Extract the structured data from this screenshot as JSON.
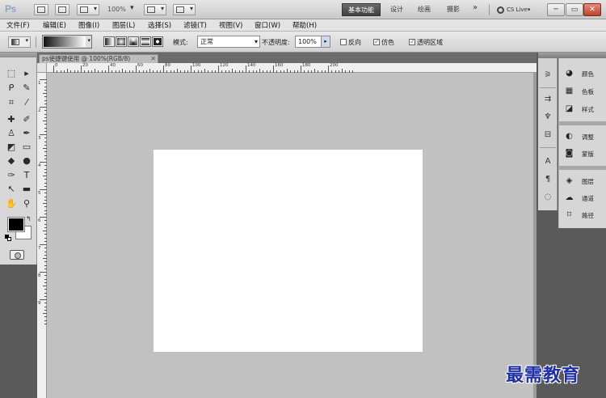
{
  "app": {
    "logo": "Ps",
    "zoom": "100%",
    "workspaces": [
      "基本功能",
      "设计",
      "绘画",
      "摄影"
    ],
    "workspace_more": "»",
    "cs_live": "CS Live"
  },
  "menu": [
    "文件(F)",
    "编辑(E)",
    "图像(I)",
    "图层(L)",
    "选择(S)",
    "滤镜(T)",
    "视图(V)",
    "窗口(W)",
    "帮助(H)"
  ],
  "options": {
    "mode_label": "模式:",
    "mode_value": "正常",
    "opacity_label": "不透明度:",
    "opacity_value": "100%",
    "reverse": "反向",
    "dither": "仿色",
    "transparency": "透明区域",
    "reverse_checked": false,
    "dither_checked": true,
    "transparency_checked": true
  },
  "document": {
    "tab_title": "ps使捷键使用 @ 100%(RGB/8)",
    "tab_close": "✕",
    "ruler_top_labels": [
      "0",
      "20",
      "40",
      "60",
      "80",
      "100",
      "120",
      "140",
      "160",
      "180",
      "200"
    ],
    "ruler_left_labels": [
      "1",
      "2",
      "3",
      "4",
      "5",
      "6",
      "7",
      "8",
      "9"
    ]
  },
  "panels": [
    {
      "icon": "color-icon",
      "label": "颜色"
    },
    {
      "icon": "swatches-icon",
      "label": "色板"
    },
    {
      "icon": "styles-icon",
      "label": "样式"
    },
    {
      "icon": "adjustments-icon",
      "label": "调整"
    },
    {
      "icon": "masks-icon",
      "label": "蒙版"
    },
    {
      "icon": "layers-icon",
      "label": "图层"
    },
    {
      "icon": "channels-icon",
      "label": "通道"
    },
    {
      "icon": "paths-icon",
      "label": "路径"
    }
  ],
  "colors": {
    "foreground": "#000000",
    "background": "#ffffff",
    "pasteboard": "#c1c1c1",
    "active_workspace": "#4a4a4a"
  },
  "watermark": "最需教育"
}
